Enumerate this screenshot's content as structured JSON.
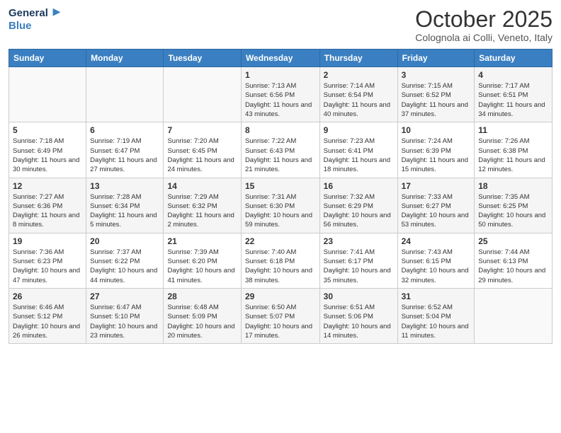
{
  "header": {
    "logo_line1": "General",
    "logo_line2": "Blue",
    "month": "October 2025",
    "location": "Colognola ai Colli, Veneto, Italy"
  },
  "weekdays": [
    "Sunday",
    "Monday",
    "Tuesday",
    "Wednesday",
    "Thursday",
    "Friday",
    "Saturday"
  ],
  "weeks": [
    [
      {
        "day": "",
        "info": ""
      },
      {
        "day": "",
        "info": ""
      },
      {
        "day": "",
        "info": ""
      },
      {
        "day": "1",
        "info": "Sunrise: 7:13 AM\nSunset: 6:56 PM\nDaylight: 11 hours and 43 minutes."
      },
      {
        "day": "2",
        "info": "Sunrise: 7:14 AM\nSunset: 6:54 PM\nDaylight: 11 hours and 40 minutes."
      },
      {
        "day": "3",
        "info": "Sunrise: 7:15 AM\nSunset: 6:52 PM\nDaylight: 11 hours and 37 minutes."
      },
      {
        "day": "4",
        "info": "Sunrise: 7:17 AM\nSunset: 6:51 PM\nDaylight: 11 hours and 34 minutes."
      }
    ],
    [
      {
        "day": "5",
        "info": "Sunrise: 7:18 AM\nSunset: 6:49 PM\nDaylight: 11 hours and 30 minutes."
      },
      {
        "day": "6",
        "info": "Sunrise: 7:19 AM\nSunset: 6:47 PM\nDaylight: 11 hours and 27 minutes."
      },
      {
        "day": "7",
        "info": "Sunrise: 7:20 AM\nSunset: 6:45 PM\nDaylight: 11 hours and 24 minutes."
      },
      {
        "day": "8",
        "info": "Sunrise: 7:22 AM\nSunset: 6:43 PM\nDaylight: 11 hours and 21 minutes."
      },
      {
        "day": "9",
        "info": "Sunrise: 7:23 AM\nSunset: 6:41 PM\nDaylight: 11 hours and 18 minutes."
      },
      {
        "day": "10",
        "info": "Sunrise: 7:24 AM\nSunset: 6:39 PM\nDaylight: 11 hours and 15 minutes."
      },
      {
        "day": "11",
        "info": "Sunrise: 7:26 AM\nSunset: 6:38 PM\nDaylight: 11 hours and 12 minutes."
      }
    ],
    [
      {
        "day": "12",
        "info": "Sunrise: 7:27 AM\nSunset: 6:36 PM\nDaylight: 11 hours and 8 minutes."
      },
      {
        "day": "13",
        "info": "Sunrise: 7:28 AM\nSunset: 6:34 PM\nDaylight: 11 hours and 5 minutes."
      },
      {
        "day": "14",
        "info": "Sunrise: 7:29 AM\nSunset: 6:32 PM\nDaylight: 11 hours and 2 minutes."
      },
      {
        "day": "15",
        "info": "Sunrise: 7:31 AM\nSunset: 6:30 PM\nDaylight: 10 hours and 59 minutes."
      },
      {
        "day": "16",
        "info": "Sunrise: 7:32 AM\nSunset: 6:29 PM\nDaylight: 10 hours and 56 minutes."
      },
      {
        "day": "17",
        "info": "Sunrise: 7:33 AM\nSunset: 6:27 PM\nDaylight: 10 hours and 53 minutes."
      },
      {
        "day": "18",
        "info": "Sunrise: 7:35 AM\nSunset: 6:25 PM\nDaylight: 10 hours and 50 minutes."
      }
    ],
    [
      {
        "day": "19",
        "info": "Sunrise: 7:36 AM\nSunset: 6:23 PM\nDaylight: 10 hours and 47 minutes."
      },
      {
        "day": "20",
        "info": "Sunrise: 7:37 AM\nSunset: 6:22 PM\nDaylight: 10 hours and 44 minutes."
      },
      {
        "day": "21",
        "info": "Sunrise: 7:39 AM\nSunset: 6:20 PM\nDaylight: 10 hours and 41 minutes."
      },
      {
        "day": "22",
        "info": "Sunrise: 7:40 AM\nSunset: 6:18 PM\nDaylight: 10 hours and 38 minutes."
      },
      {
        "day": "23",
        "info": "Sunrise: 7:41 AM\nSunset: 6:17 PM\nDaylight: 10 hours and 35 minutes."
      },
      {
        "day": "24",
        "info": "Sunrise: 7:43 AM\nSunset: 6:15 PM\nDaylight: 10 hours and 32 minutes."
      },
      {
        "day": "25",
        "info": "Sunrise: 7:44 AM\nSunset: 6:13 PM\nDaylight: 10 hours and 29 minutes."
      }
    ],
    [
      {
        "day": "26",
        "info": "Sunrise: 6:46 AM\nSunset: 5:12 PM\nDaylight: 10 hours and 26 minutes."
      },
      {
        "day": "27",
        "info": "Sunrise: 6:47 AM\nSunset: 5:10 PM\nDaylight: 10 hours and 23 minutes."
      },
      {
        "day": "28",
        "info": "Sunrise: 6:48 AM\nSunset: 5:09 PM\nDaylight: 10 hours and 20 minutes."
      },
      {
        "day": "29",
        "info": "Sunrise: 6:50 AM\nSunset: 5:07 PM\nDaylight: 10 hours and 17 minutes."
      },
      {
        "day": "30",
        "info": "Sunrise: 6:51 AM\nSunset: 5:06 PM\nDaylight: 10 hours and 14 minutes."
      },
      {
        "day": "31",
        "info": "Sunrise: 6:52 AM\nSunset: 5:04 PM\nDaylight: 10 hours and 11 minutes."
      },
      {
        "day": "",
        "info": ""
      }
    ]
  ]
}
